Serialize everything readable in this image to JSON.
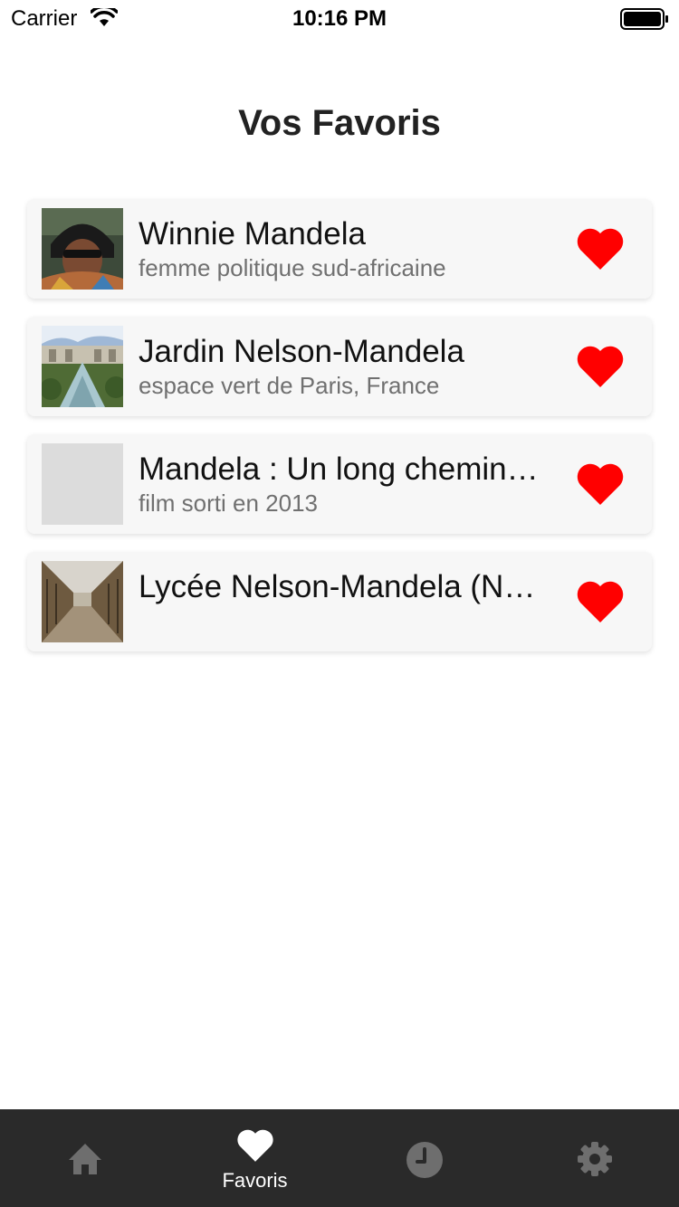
{
  "status_bar": {
    "carrier": "Carrier",
    "time": "10:16 PM"
  },
  "header": {
    "title": "Vos Favoris"
  },
  "favorites": [
    {
      "title": "Winnie Mandela",
      "subtitle": "femme politique sud-africaine",
      "thumbnail": "portrait-photo",
      "favorited": true
    },
    {
      "title": "Jardin Nelson-Mandela",
      "subtitle": "espace vert de Paris, France",
      "thumbnail": "garden-photo",
      "favorited": true
    },
    {
      "title": "Mandela : Un long chemin…",
      "subtitle": "film sorti en 2013",
      "thumbnail": "placeholder",
      "favorited": true
    },
    {
      "title": "Lycée Nelson-Mandela (N…",
      "subtitle": "",
      "thumbnail": "hallway-photo",
      "favorited": true
    }
  ],
  "tab_bar": {
    "active_tab": "favoris",
    "tabs": [
      {
        "id": "home",
        "icon": "home-icon",
        "label": ""
      },
      {
        "id": "favoris",
        "icon": "heart-icon",
        "label": "Favoris"
      },
      {
        "id": "history",
        "icon": "clock-icon",
        "label": ""
      },
      {
        "id": "settings",
        "icon": "gear-icon",
        "label": ""
      }
    ]
  },
  "colors": {
    "heart": "#ff0000",
    "tab_bar_bg": "#2a2a2a",
    "tab_active": "#ffffff",
    "tab_inactive": "#6e6e6e",
    "card_bg": "#f7f7f7",
    "subtitle": "#707070"
  }
}
